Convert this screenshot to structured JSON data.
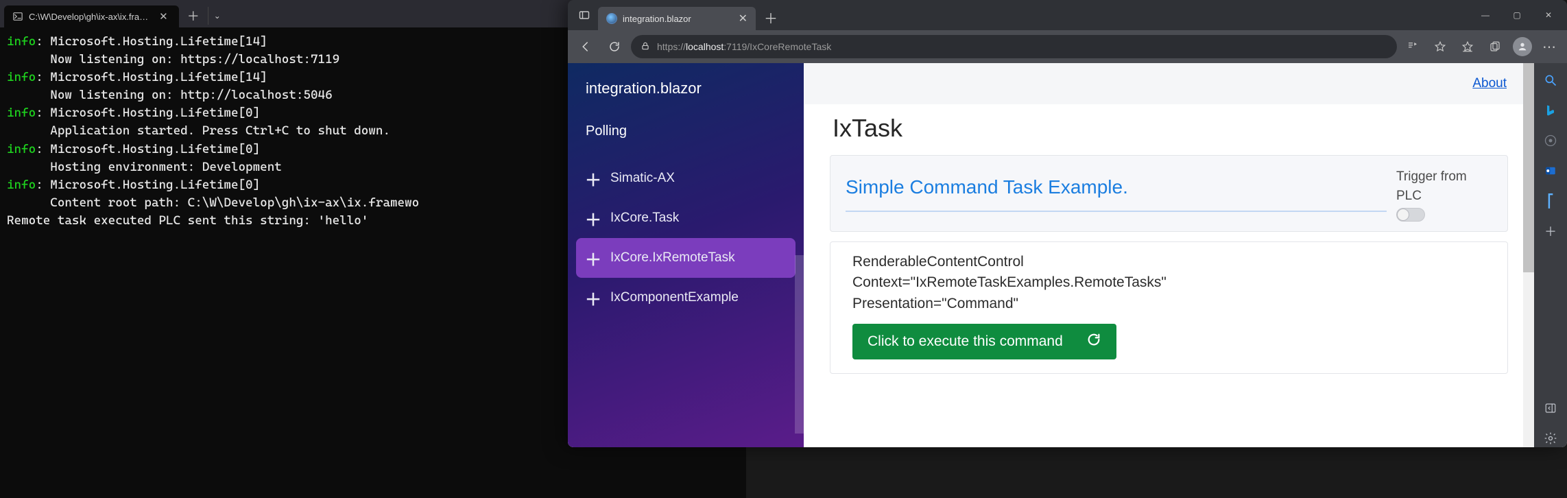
{
  "terminal": {
    "tab_title": "C:\\W\\Develop\\gh\\ix-ax\\ix.fra…",
    "lines": [
      {
        "prefix": "info",
        "text": ": Microsoft.Hosting.Lifetime[14]"
      },
      {
        "prefix": "",
        "text": "      Now listening on: https://localhost:7119"
      },
      {
        "prefix": "info",
        "text": ": Microsoft.Hosting.Lifetime[14]"
      },
      {
        "prefix": "",
        "text": "      Now listening on: http://localhost:5046"
      },
      {
        "prefix": "info",
        "text": ": Microsoft.Hosting.Lifetime[0]"
      },
      {
        "prefix": "",
        "text": "      Application started. Press Ctrl+C to shut down."
      },
      {
        "prefix": "info",
        "text": ": Microsoft.Hosting.Lifetime[0]"
      },
      {
        "prefix": "",
        "text": "      Hosting environment: Development"
      },
      {
        "prefix": "info",
        "text": ": Microsoft.Hosting.Lifetime[0]"
      },
      {
        "prefix": "",
        "text": "      Content root path: C:\\W\\Develop\\gh\\ix-ax\\ix.framewo"
      },
      {
        "prefix": "",
        "text": "Remote task executed PLC sent this string: 'hello'"
      }
    ]
  },
  "browser": {
    "tab_title": "integration.blazor",
    "url_prefix": "https://",
    "url_host_strong": "localhost",
    "url_host_port": ":7119",
    "url_path": "/IxCoreRemoteTask",
    "win_min": "—",
    "win_max": "▢",
    "win_close": "✕"
  },
  "page": {
    "brand": "integration.blazor",
    "polling": "Polling",
    "about": "About",
    "nav": [
      {
        "label": "Simatic-AX",
        "active": false
      },
      {
        "label": "IxCore.Task",
        "active": false
      },
      {
        "label": "IxCore.IxRemoteTask",
        "active": true
      },
      {
        "label": "IxComponentExample",
        "active": false
      }
    ],
    "h1": "IxTask",
    "card_title": "Simple Command Task Example.",
    "trigger_line1": "Trigger from",
    "trigger_line2": "PLC",
    "box_line1": "RenderableContentControl",
    "box_line2": "Context=\"IxRemoteTaskExamples.RemoteTasks\"",
    "box_line3": "Presentation=\"Command\"",
    "exec_label": "Click to execute this command"
  }
}
